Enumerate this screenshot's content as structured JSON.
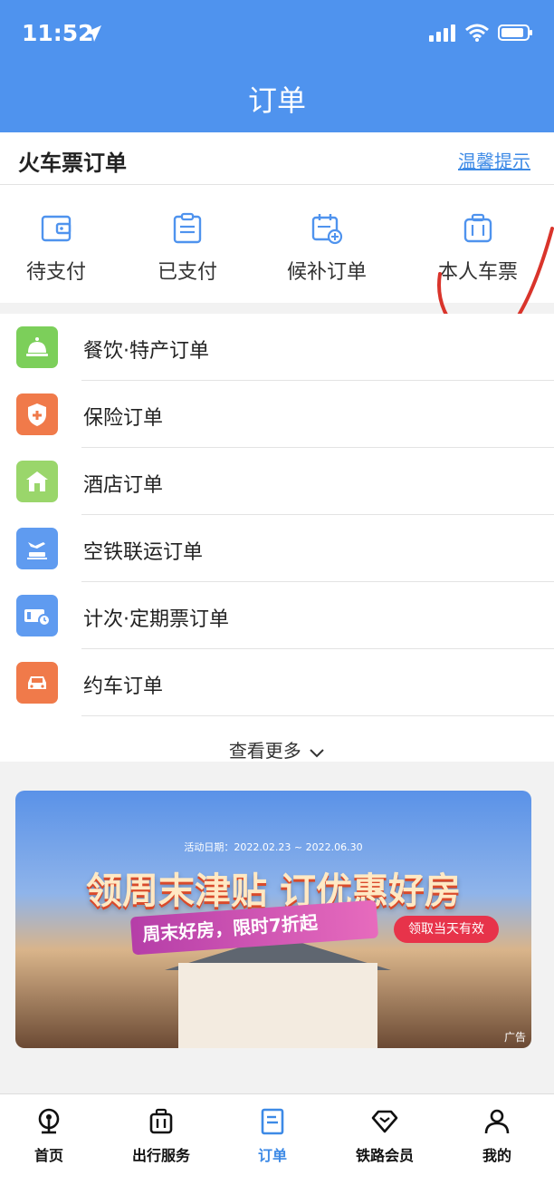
{
  "status_bar": {
    "time": "11:52"
  },
  "header": {
    "title": "订单"
  },
  "ticket_orders": {
    "title": "火车票订单",
    "tip_link": "温馨提示",
    "categories": [
      {
        "label": "待支付",
        "icon": "wallet-icon"
      },
      {
        "label": "已支付",
        "icon": "clipboard-icon"
      },
      {
        "label": "候补订单",
        "icon": "calendar-add-icon"
      },
      {
        "label": "本人车票",
        "icon": "luggage-icon"
      }
    ]
  },
  "order_list": {
    "items": [
      {
        "label": "餐饮·特产订单",
        "icon": "food-bell-icon",
        "color": "#7ccf5a"
      },
      {
        "label": "保险订单",
        "icon": "shield-plus-icon",
        "color": "#f07a4a"
      },
      {
        "label": "酒店订单",
        "icon": "hotel-icon",
        "color": "#9ad66b"
      },
      {
        "label": "空铁联运订单",
        "icon": "plane-train-icon",
        "color": "#5f9bf0"
      },
      {
        "label": "计次·定期票订单",
        "icon": "ticket-clock-icon",
        "color": "#5f9bf0"
      },
      {
        "label": "约车订单",
        "icon": "car-icon",
        "color": "#f07a4a"
      }
    ],
    "more": "查看更多"
  },
  "banner": {
    "date": "活动日期：2022.02.23 ~ 2022.06.30",
    "title": "领周末津贴 订优惠好房",
    "subtitle": "周末好房，限时7折起",
    "pill": "领取当天有效",
    "ad_label": "广告"
  },
  "tabbar": {
    "tabs": [
      {
        "label": "首页",
        "icon": "railway-logo-icon"
      },
      {
        "label": "出行服务",
        "icon": "luggage-icon"
      },
      {
        "label": "订单",
        "icon": "order-doc-icon"
      },
      {
        "label": "铁路会员",
        "icon": "diamond-icon"
      },
      {
        "label": "我的",
        "icon": "person-icon"
      }
    ],
    "active_index": 2
  },
  "colors": {
    "header_bg": "#4f93ee",
    "accent": "#3d8ae6",
    "annotation": "#d9342b"
  }
}
